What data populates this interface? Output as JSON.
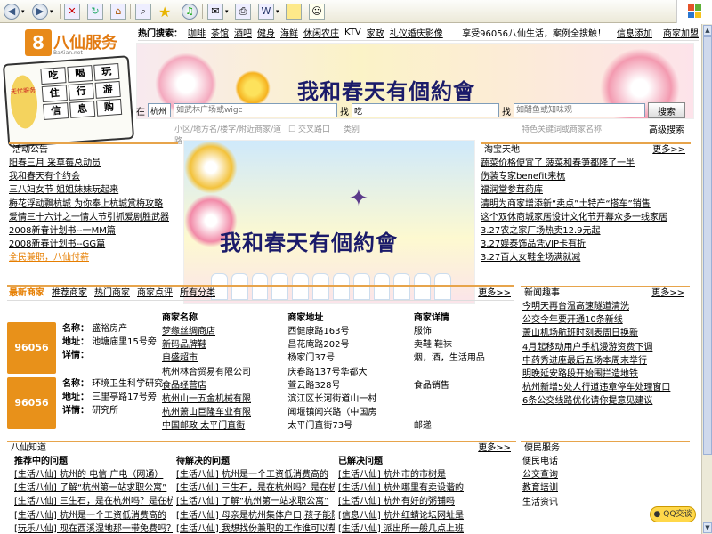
{
  "header": {
    "logo_text": "八仙服务",
    "logo_sub": "BaXian.net",
    "calc_side": "无忧服务",
    "calc_keys": [
      "吃",
      "喝",
      "玩",
      "住",
      "行",
      "游",
      "信",
      "息",
      "购"
    ],
    "hot_label": "热门搜索：",
    "hot_items": [
      "咖啡",
      "茶馆",
      "酒吧",
      "健身",
      "海鲜",
      "休闲农庄",
      "KTV",
      "家政",
      "礼仪婚庆影像"
    ],
    "hot_slogan": "享受96056八仙生活，案例全搜触！",
    "hot_links": [
      "信息添加",
      "商家加盟"
    ]
  },
  "banner": {
    "title": "我和春天有個約會"
  },
  "search": {
    "in_label": "在",
    "city": "杭州",
    "place_placeholder": "如武林广场或wigc",
    "find_label": "找",
    "keyword": "吃",
    "shop_label": "找",
    "shop_placeholder": "如醋鱼或知味观",
    "button": "搜索",
    "hint1": "小区/地方名/楼字/附近商家/道路",
    "hint_check": "交叉路口",
    "hint2": "类别",
    "hint3": "特色关键词或商家名称",
    "advanced": "高级搜索"
  },
  "activity": {
    "title": "活动公告",
    "items": [
      "阳春三月 采草莓总动员",
      "我和春天有个约会",
      "三八妇女节 姐姐妹妹玩起来",
      "梅花浮动飘杭城 为你奉上杭城赏梅攻略",
      "爱情三十六计之一情人节引抓爱剧胜武器",
      "2008新春计划书--一MM篇",
      "2008新春计划书--GG篇",
      "全民兼职，八仙付薪"
    ]
  },
  "taobao": {
    "title": "淘宝天地",
    "more": "更多>>",
    "items": [
      "蔬菜价格便宜了 菠菜和春笋都降了一半",
      "伤装专家benefit来杭",
      "福润堂参茸药库",
      "清明为商家增添新“卖点”土特产“搭车”销售",
      "这个双休商城家居设计文化节开幕众多一线家居",
      "3.27农之家厂场热卖12.9元起",
      "3.27娱泰饰品凭VIP卡有折",
      "3.27百大女鞋全场满就减"
    ]
  },
  "merch": {
    "tabs": [
      "最新商家",
      "推荐商家",
      "热门商家",
      "商家点评",
      "所有分类"
    ],
    "more": "更多>>",
    "card1": {
      "logo": "96056",
      "name_label": "名称：",
      "name": "盛裕房产",
      "addr_label": "地址：",
      "addr": "池塘庙里15号旁",
      "detail_label": "详情："
    },
    "card2": {
      "logo": "96056",
      "name_label": "名称：",
      "name": "环境卫生科学研究",
      "addr_label": "地址：",
      "addr": "三里亭路17号旁",
      "detail_label": "详情：",
      "detail": "研究所"
    },
    "table": {
      "headers": [
        "商家名称",
        "商家地址",
        "商家详情"
      ],
      "rows": [
        [
          "梦缘丝绸商店",
          "西健康路163号",
          "服饰"
        ],
        [
          "新码品牌鞋",
          "昌花庵路202号",
          "卖鞋 鞋袜"
        ],
        [
          "自盛超市",
          "杨家门37号",
          "烟，酒，生活用品"
        ],
        [
          "杭州林合贸易有限公司",
          "庆春路137号华都大",
          ""
        ],
        [
          "食品经营店",
          "萱云路328号",
          "食品销售"
        ],
        [
          "杭州山一五金机械有限",
          "滨江区长河街道山一村",
          ""
        ],
        [
          "杭州萧山巨隆车业有限",
          "闻堰镇闻兴路（中国房",
          ""
        ],
        [
          "中国邮政 太平门直街",
          "太平门直街73号",
          "邮递"
        ]
      ]
    }
  },
  "news": {
    "title": "新闻趣事",
    "more": "更多>>",
    "items": [
      "今明天再台温高速隧道清洗",
      "公交今年要开通10条新线",
      "萧山机场航班时刻表周日换新",
      "4月起移动用户手机漫游资费下调",
      "中药秀进座最后五场本周末举行",
      "明晚延安路段开始围拦造地铁",
      "杭州新增5处人行道违章停车处理窗口",
      "6条公交线路优化请你提意见建议"
    ]
  },
  "knowledge": {
    "title": "八仙知道",
    "more": "更多>>",
    "cols": [
      {
        "head": "推荐中的问题",
        "rows": [
          "[生活八仙] 杭州的 电信 广电（网通）",
          "[生活八仙] 了解“杭州第一站求职公寓”",
          "[生活八仙] 三生石，是在杭州吗？是在杭",
          "[生活八仙] 杭州是一个工资低消费高的",
          "[玩乐八仙] 现在西溪湿地那一带免费吗？"
        ]
      },
      {
        "head": "待解决的问题",
        "rows": [
          "[生活八仙] 杭州是一个工资低消费高的",
          "[生活八仙] 三生石，是在杭州吗？是在杭",
          "[生活八仙] 了解“杭州第一站求职公寓”",
          "[生活八仙] 母亲是杭州集体户口,孩子能随",
          "[生活八仙] 我想找份兼职的工作谁可以帮"
        ]
      },
      {
        "head": "已解决问题",
        "rows": [
          "[生活八仙] 杭州市的市树是",
          "[生活八仙] 杭州哪里有卖设谐的",
          "[生活八仙] 杭州有好的粥铺吗",
          "[信息八仙] 杭州红蜻论坛网址是",
          "[生活八仙] 派出所一般几点上班"
        ]
      }
    ]
  },
  "service": {
    "title": "便民服务",
    "items": [
      "便民电话",
      "公交查询",
      "教育培训",
      "生活资讯"
    ]
  },
  "qq": {
    "label": "QQ交谈"
  },
  "colors": {
    "accent": "#e7a44b",
    "logo": "#e88a1a"
  }
}
